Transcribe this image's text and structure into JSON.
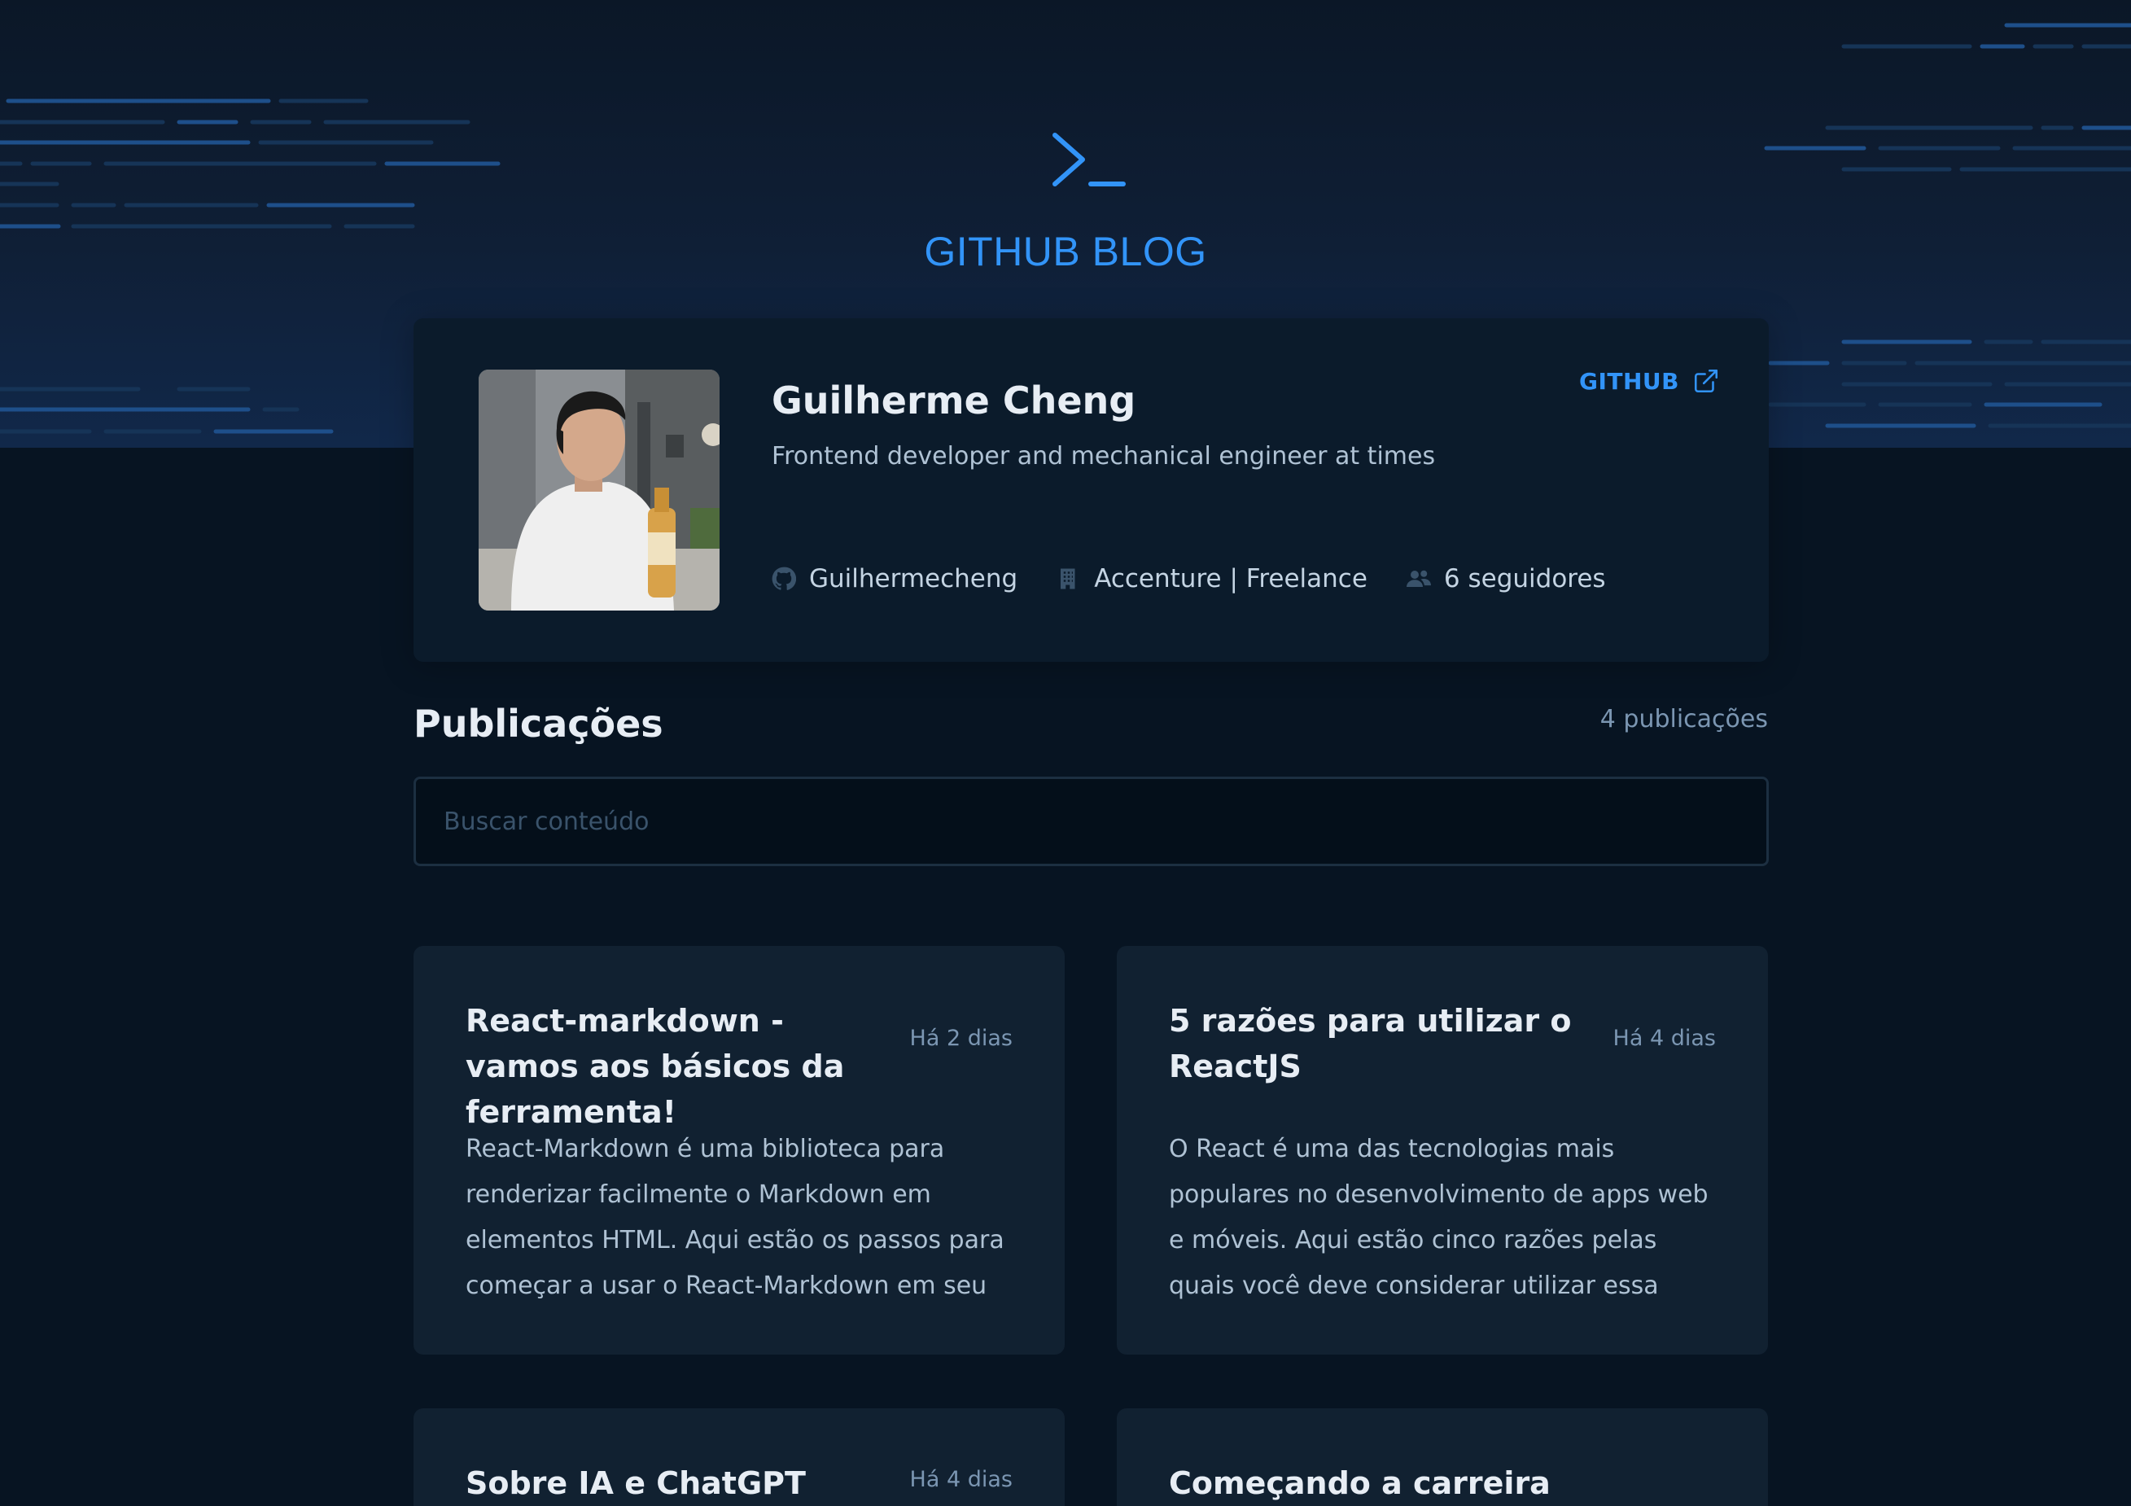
{
  "header": {
    "brand_title": "GITHUB BLOG",
    "logo_icon": "terminal-prompt-icon"
  },
  "profile": {
    "name": "Guilherme Cheng",
    "bio": "Frontend developer and mechanical engineer at times",
    "github_link_label": "GITHUB",
    "username": "Guilhermecheng",
    "company": "Accenture | Freelance",
    "followers": "6 seguidores"
  },
  "publications": {
    "title": "Publicações",
    "count": "4 publicações",
    "search_placeholder": "Buscar conteúdo",
    "search_value": "",
    "posts": [
      {
        "title": "React-markdown - vamos aos básicos da ferramenta!",
        "date": "Há 2 dias",
        "excerpt": "React-Markdown é uma biblioteca para renderizar facilmente o Markdown em elementos HTML. Aqui estão os passos para começar a usar o React-Markdown em seu"
      },
      {
        "title": "5 razões para utilizar o ReactJS",
        "date": "Há 4 dias",
        "excerpt": "O React é uma das tecnologias mais populares no desenvolvimento de apps web e móveis. Aqui estão cinco razões pelas quais você deve considerar utilizar essa tecnologia!"
      },
      {
        "title": "Sobre IA e ChatGPT",
        "date": "Há 4 dias",
        "excerpt": ""
      },
      {
        "title": "Começando a carreira na",
        "date": "",
        "excerpt": ""
      }
    ]
  },
  "colors": {
    "background": "#071422",
    "header_bg": "#0f1f36",
    "card_bg": "#0b1b2b",
    "post_bg": "#112131",
    "accent": "#3294f8",
    "title_text": "#e7edf4",
    "muted_text": "#7b96b2"
  }
}
